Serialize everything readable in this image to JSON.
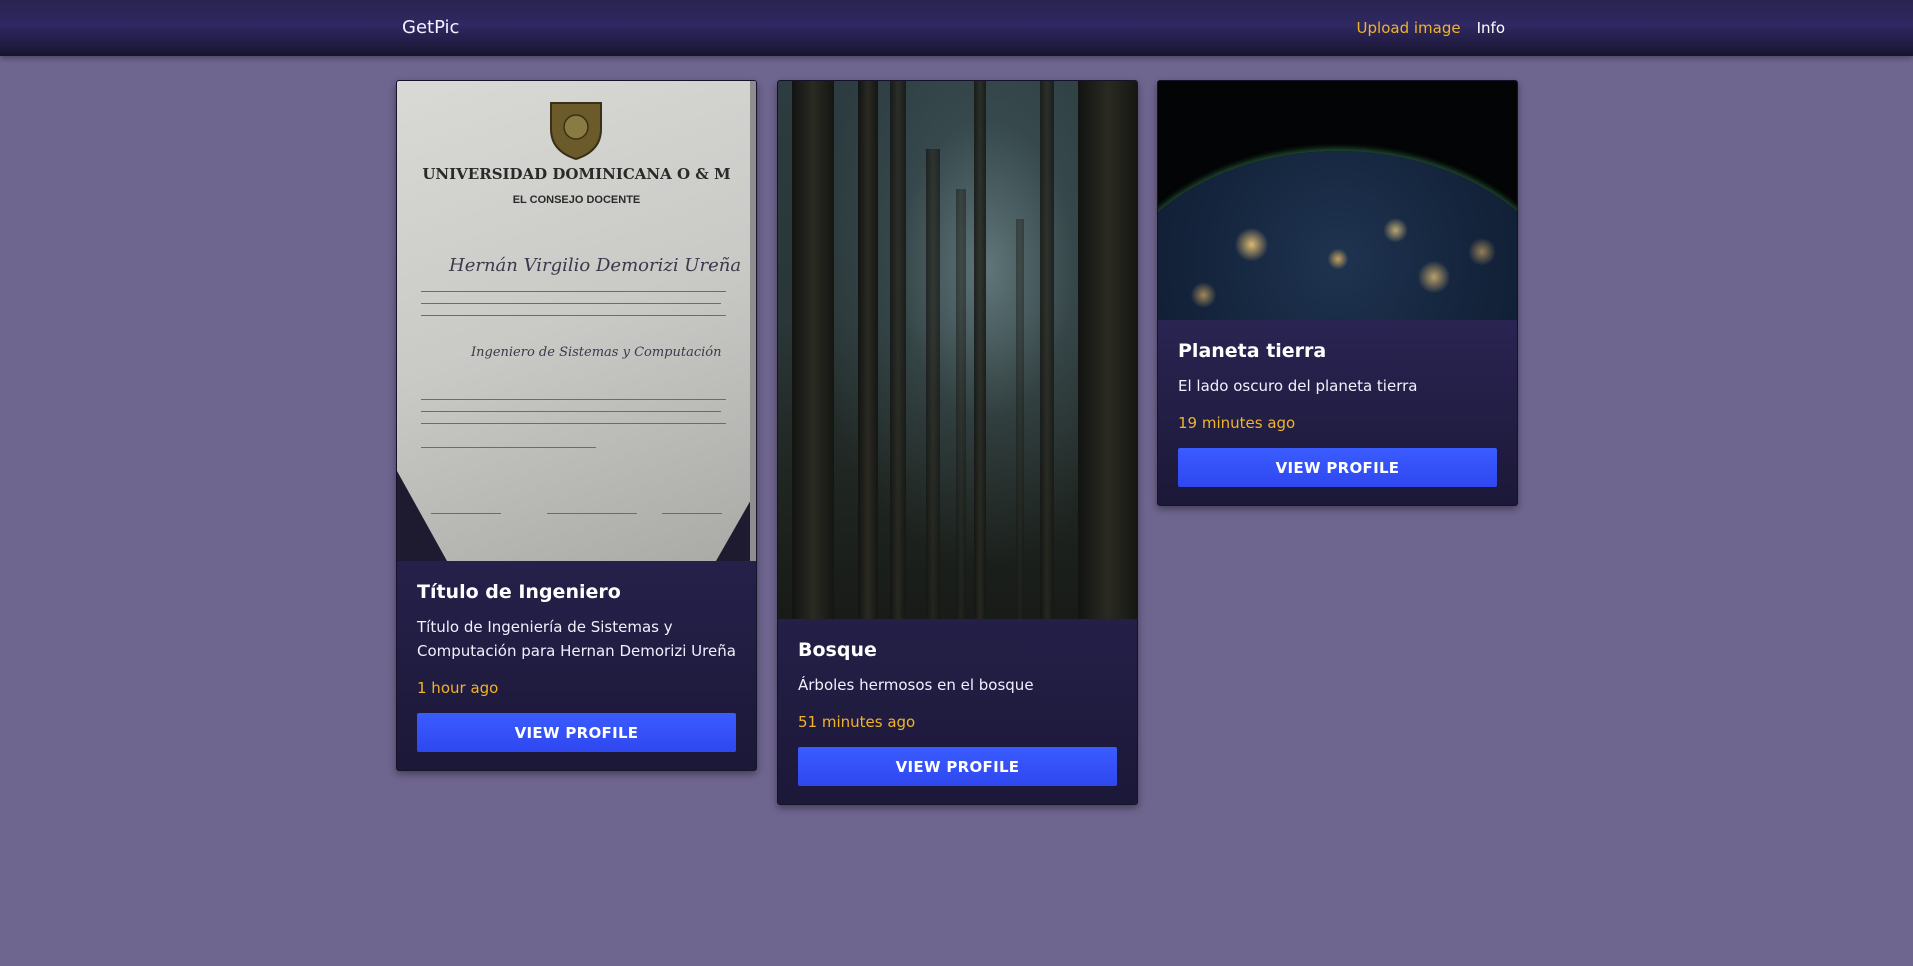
{
  "navbar": {
    "brand": "GetPic",
    "upload_label": "Upload image",
    "info_label": "Info"
  },
  "cards": [
    {
      "title": "Título de Ingeniero",
      "description": "Título de Ingeniería de Sistemas y Computación para Hernan Demorizi Ureña",
      "time": "1 hour ago",
      "button_label": "VIEW PROFILE",
      "image": {
        "alt": "Diploma photo",
        "heading": "UNIVERSIDAD DOMINICANA O & M",
        "council": "EL CONSEJO DOCENTE",
        "name": "Hernán Virgilio Demorizi Ureña",
        "degree": "Ingeniero de Sistemas y Computación"
      }
    },
    {
      "title": "Bosque",
      "description": "Árboles hermosos en el bosque",
      "time": "51 minutes ago",
      "button_label": "VIEW PROFILE",
      "image": {
        "alt": "Foggy forest"
      }
    },
    {
      "title": "Planeta tierra",
      "description": "El lado oscuro del planeta tierra",
      "time": "19 minutes ago",
      "button_label": "VIEW PROFILE",
      "image": {
        "alt": "Earth at night"
      }
    }
  ],
  "colors": {
    "background": "#6f6690",
    "accent": "#f0b429",
    "button": "#3a5cff",
    "navbar": "#2f2862"
  }
}
